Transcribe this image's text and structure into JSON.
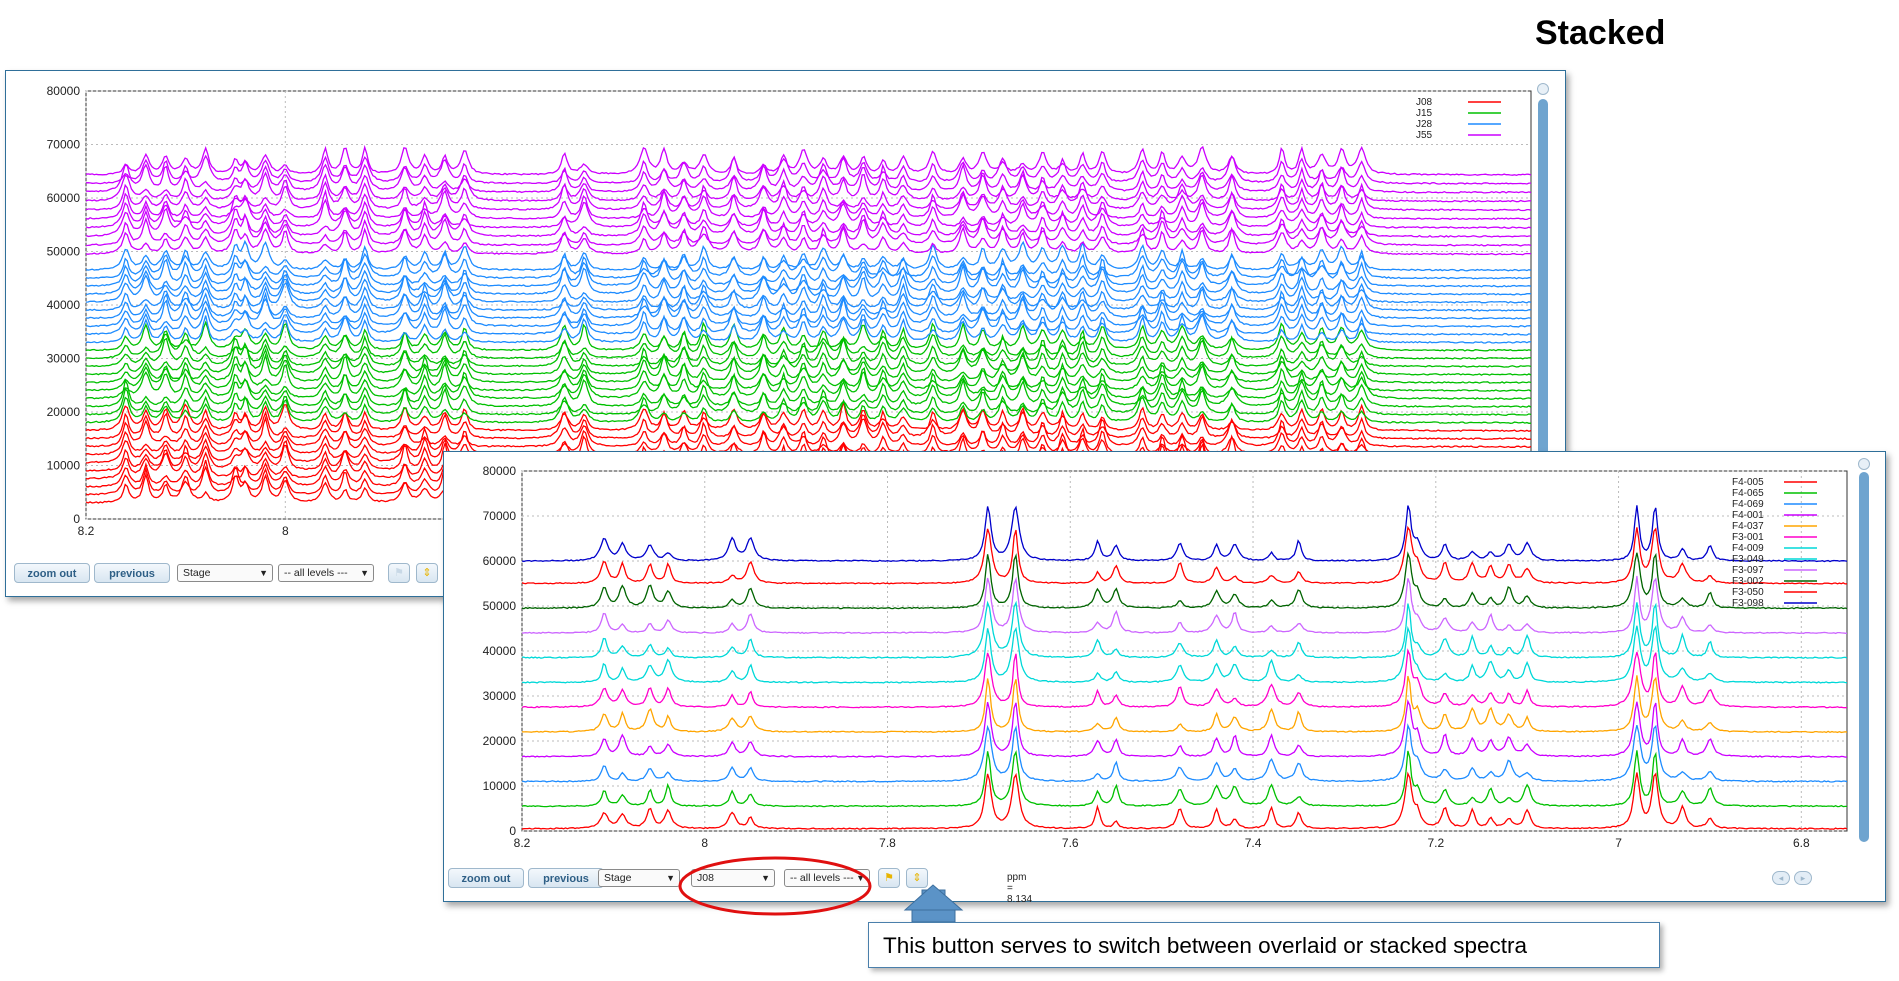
{
  "heading": "Stacked",
  "colors": {
    "panel_border": "#2f6f99",
    "button_text": "#2e5f86",
    "annotation_red": "#e01010",
    "arrow_blue": "#5b93c7"
  },
  "panel_top": {
    "toolbar": {
      "zoom_out_label": "zoom out",
      "previous_label": "previous",
      "stage_select": "Stage",
      "levels_select": "-- all levels ---",
      "icons": [
        "flag-icon",
        "stack-toggle-icon"
      ]
    }
  },
  "panel_bottom": {
    "toolbar": {
      "zoom_out_label": "zoom out",
      "previous_label": "previous",
      "stage_select": "Stage",
      "sample_select": "J08",
      "levels_select": "-- all levels ---",
      "icons": [
        "flag-icon",
        "stack-toggle-icon",
        "nav-back-icon",
        "nav-forward-icon"
      ],
      "ppm_readout": "ppm = 8.134"
    }
  },
  "callout": {
    "text": "This button serves to switch between overlaid or stacked spectra"
  },
  "chart_data": [
    {
      "type": "line",
      "mode": "stacked",
      "xlabel": "",
      "ylabel": "",
      "x_reversed": true,
      "xlim": [
        8.2,
        6.75
      ],
      "ylim": [
        0,
        80000
      ],
      "x_ticks": [
        "8.2",
        "8"
      ],
      "y_ticks": [
        "0",
        "10000",
        "20000",
        "30000",
        "40000",
        "50000",
        "60000",
        "70000",
        "80000"
      ],
      "grid": true,
      "legend_position": "top-right",
      "series": [
        {
          "name": "J08",
          "color": "#ff0000",
          "traces": 10,
          "base_start": 3000,
          "spacing": 1500
        },
        {
          "name": "J15",
          "color": "#00c000",
          "traces": 10,
          "base_start": 18000,
          "spacing": 1500
        },
        {
          "name": "J28",
          "color": "#1e8cff",
          "traces": 10,
          "base_start": 33000,
          "spacing": 1500
        },
        {
          "name": "J55",
          "color": "#cc00ff",
          "traces": 10,
          "base_start": 49500,
          "spacing": 1650
        }
      ],
      "peaks_ppm": [
        8.16,
        8.14,
        8.12,
        8.1,
        8.08,
        8.05,
        8.04,
        8.02,
        8.0,
        7.96,
        7.94,
        7.92,
        7.88,
        7.86,
        7.84,
        7.82,
        7.72,
        7.7,
        7.64,
        7.62,
        7.6,
        7.58,
        7.55,
        7.52,
        7.5,
        7.48,
        7.46,
        7.44,
        7.42,
        7.4,
        7.38,
        7.35,
        7.32,
        7.3,
        7.28,
        7.26,
        7.24,
        7.22,
        7.2,
        7.18,
        7.14,
        7.12,
        7.1,
        7.08,
        7.05,
        7.0,
        6.98,
        6.96,
        6.94,
        6.92
      ]
    },
    {
      "type": "line",
      "mode": "stacked",
      "xlabel": "",
      "ylabel": "",
      "x_reversed": true,
      "xlim": [
        8.2,
        6.75
      ],
      "ylim": [
        0,
        80000
      ],
      "x_ticks": [
        "8.2",
        "8",
        "7.8",
        "7.6",
        "7.4",
        "7.2",
        "7",
        "6.8"
      ],
      "y_ticks": [
        "0",
        "10000",
        "20000",
        "30000",
        "40000",
        "50000",
        "60000",
        "70000",
        "80000"
      ],
      "grid": true,
      "legend_position": "top-right",
      "series": [
        {
          "name": "F4-005",
          "color": "#ff0000",
          "baseline": 500
        },
        {
          "name": "F4-065",
          "color": "#00c000",
          "baseline": 5500
        },
        {
          "name": "F4-069",
          "color": "#1e8cff",
          "baseline": 11000
        },
        {
          "name": "F4-001",
          "color": "#cc00ff",
          "baseline": 16500
        },
        {
          "name": "F4-037",
          "color": "#ffa500",
          "baseline": 22000
        },
        {
          "name": "F3-001",
          "color": "#ff00cc",
          "baseline": 27500
        },
        {
          "name": "F4-009",
          "color": "#00d8d8",
          "baseline": 33000
        },
        {
          "name": "F3-049",
          "color": "#00d8d8",
          "baseline": 38500
        },
        {
          "name": "F3-097",
          "color": "#cc66ff",
          "baseline": 44000
        },
        {
          "name": "F3-002",
          "color": "#006400",
          "baseline": 49500
        },
        {
          "name": "F3-050",
          "color": "#ff0000",
          "baseline": 55000
        },
        {
          "name": "F3-098",
          "color": "#0000cc",
          "baseline": 60000
        }
      ],
      "peaks_ppm": [
        8.11,
        8.09,
        8.06,
        8.04,
        7.97,
        7.95,
        7.69,
        7.66,
        7.57,
        7.55,
        7.48,
        7.44,
        7.42,
        7.38,
        7.35,
        7.23,
        7.22,
        7.19,
        7.16,
        7.14,
        7.12,
        7.1,
        6.98,
        6.96,
        6.93,
        6.9
      ],
      "tall_peaks_ppm": [
        7.69,
        7.66,
        7.23,
        6.98,
        6.96
      ]
    }
  ]
}
